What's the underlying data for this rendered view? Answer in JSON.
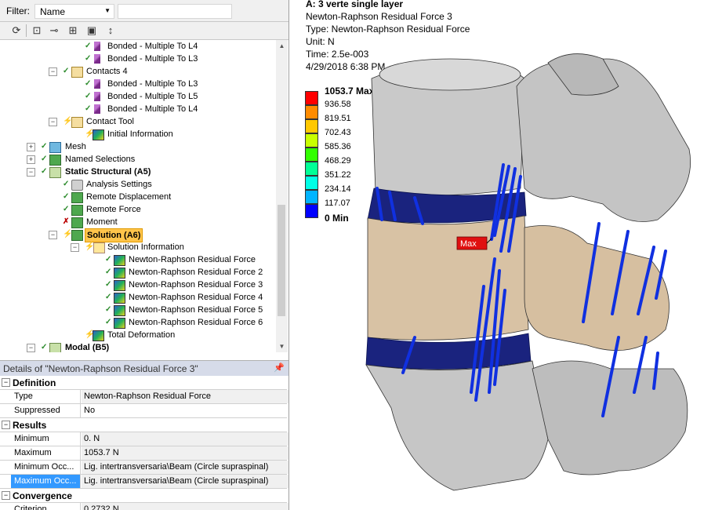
{
  "filter": {
    "label": "Filter:",
    "selected": "Name",
    "text": ""
  },
  "toolbar": {
    "icons": [
      "refresh-icon",
      "expand-all-icon",
      "collapse-icon",
      "add-icon",
      "folder-icon",
      "sort-az-icon"
    ]
  },
  "tree": [
    {
      "label": "Bonded - Multiple To L4",
      "icon": "bonded-icon"
    },
    {
      "label": "Bonded - Multiple To L3",
      "icon": "bonded-icon"
    },
    {
      "label": "Contacts 4",
      "icon": "contacts-folder-icon"
    },
    {
      "label": "Bonded - Multiple To L3",
      "icon": "bonded-icon"
    },
    {
      "label": "Bonded - Multiple To L5",
      "icon": "bonded-icon"
    },
    {
      "label": "Bonded - Multiple To L4",
      "icon": "bonded-icon"
    },
    {
      "label": "Contact Tool",
      "icon": "contact-tool-icon"
    },
    {
      "label": "Initial Information",
      "icon": "result-icon"
    },
    {
      "label": "Mesh",
      "icon": "mesh-icon"
    },
    {
      "label": "Named Selections",
      "icon": "named-selections-icon"
    },
    {
      "label": "Static Structural (A5)",
      "icon": "analysis-icon"
    },
    {
      "label": "Analysis Settings",
      "icon": "analysis-settings-icon"
    },
    {
      "label": "Remote Displacement",
      "icon": "remote-displacement-icon"
    },
    {
      "label": "Remote Force",
      "icon": "remote-force-icon"
    },
    {
      "label": "Moment",
      "icon": "moment-icon"
    },
    {
      "label": "Solution (A6)",
      "icon": "solution-icon"
    },
    {
      "label": "Solution Information",
      "icon": "solution-information-icon"
    },
    {
      "label": "Newton-Raphson Residual Force",
      "icon": "result-icon"
    },
    {
      "label": "Newton-Raphson Residual Force 2",
      "icon": "result-icon"
    },
    {
      "label": "Newton-Raphson Residual Force 3",
      "icon": "result-icon"
    },
    {
      "label": "Newton-Raphson Residual Force 4",
      "icon": "result-icon"
    },
    {
      "label": "Newton-Raphson Residual Force 5",
      "icon": "result-icon"
    },
    {
      "label": "Newton-Raphson Residual Force 6",
      "icon": "result-icon"
    },
    {
      "label": "Total Deformation",
      "icon": "result-icon"
    },
    {
      "label": "Modal (B5)",
      "icon": "modal-icon"
    }
  ],
  "details": {
    "title": "Details of \"Newton-Raphson Residual Force 3\"",
    "pin": "ₚ",
    "groups": {
      "definition": "Definition",
      "results": "Results",
      "convergence": "Convergence"
    },
    "rows": {
      "type": {
        "k": "Type",
        "v": "Newton-Raphson Residual Force"
      },
      "suppressed": {
        "k": "Suppressed",
        "v": "No"
      },
      "minimum": {
        "k": "Minimum",
        "v": "0. N"
      },
      "maximum": {
        "k": "Maximum",
        "v": "1053.7 N"
      },
      "min_occ": {
        "k": "Minimum Occ...",
        "v": "Lig. intertransversaria\\Beam (Circle supraspinal)"
      },
      "max_occ": {
        "k": "Maximum Occ...",
        "v": "Lig. intertransversaria\\Beam (Circle supraspinal)"
      },
      "criterion": {
        "k": "Criterion",
        "v": "0.2732 N"
      }
    }
  },
  "viewport": {
    "title": "A: 3 verte single layer",
    "result": "Newton-Raphson Residual Force 3",
    "type": "Type: Newton-Raphson Residual Force",
    "unit": "Unit: N",
    "time": "Time: 2.5e-003",
    "date": "4/29/2018 6:38 PM",
    "max_probe": "Max"
  },
  "legend": {
    "labels": [
      "1053.7 Max",
      "936.58",
      "819.51",
      "702.43",
      "585.36",
      "468.29",
      "351.22",
      "234.14",
      "117.07",
      "0 Min"
    ],
    "colors": [
      "#ff0000",
      "#ff8c00",
      "#ffc800",
      "#c8ff00",
      "#32ff00",
      "#00ff96",
      "#00ffe6",
      "#00b4ff",
      "#0050ff",
      "#0000ff"
    ]
  }
}
